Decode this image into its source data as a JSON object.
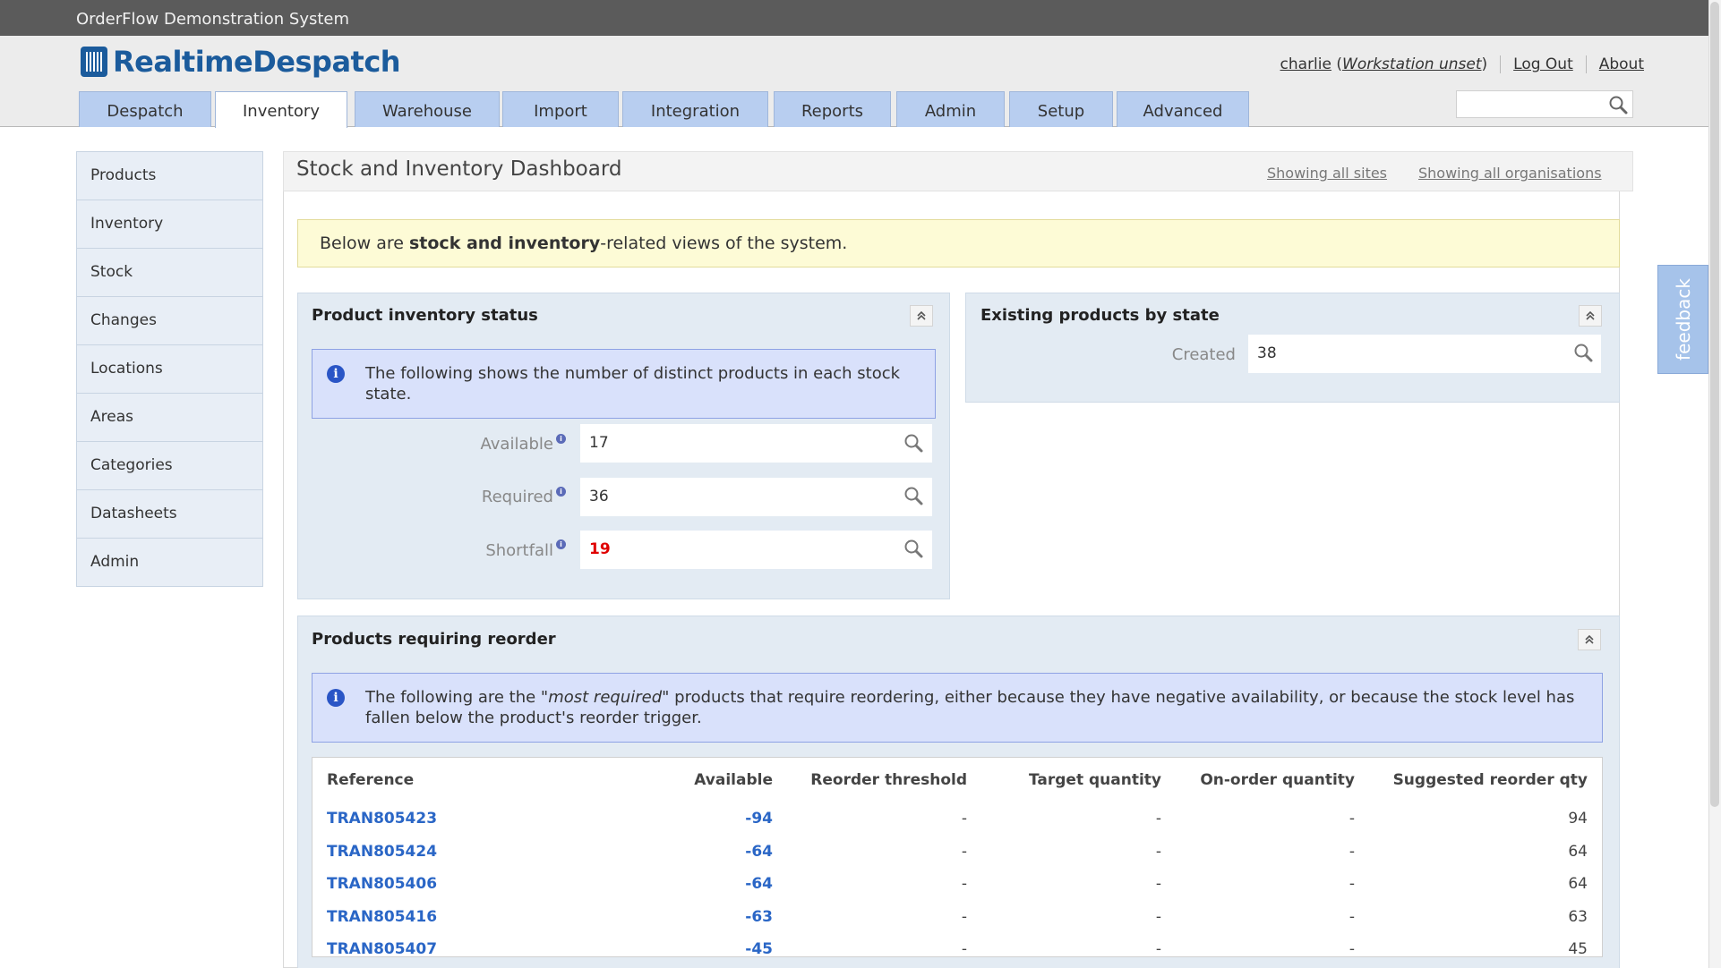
{
  "window": {
    "title": "OrderFlow Demonstration System"
  },
  "brand": {
    "logo_text": "RealtimeDespatch"
  },
  "user": {
    "name": "charlie",
    "workstation": "Workstation unset",
    "logout_label": "Log Out",
    "about_label": "About"
  },
  "tabs": [
    {
      "label": "Despatch"
    },
    {
      "label": "Inventory"
    },
    {
      "label": "Warehouse"
    },
    {
      "label": "Import"
    },
    {
      "label": "Integration"
    },
    {
      "label": "Reports"
    },
    {
      "label": "Admin"
    },
    {
      "label": "Setup"
    },
    {
      "label": "Advanced"
    }
  ],
  "search": {
    "placeholder": ""
  },
  "sidebar": {
    "items": [
      {
        "label": "Products"
      },
      {
        "label": "Inventory"
      },
      {
        "label": "Stock"
      },
      {
        "label": "Changes"
      },
      {
        "label": "Locations"
      },
      {
        "label": "Areas"
      },
      {
        "label": "Categories"
      },
      {
        "label": "Datasheets"
      },
      {
        "label": "Admin"
      }
    ]
  },
  "main": {
    "title": "Stock and Inventory Dashboard",
    "sites_link": "Showing all sites",
    "orgs_link": "Showing all organisations",
    "notice_pre": "Below are ",
    "notice_bold": "stock and inventory",
    "notice_post": "-related views of the system."
  },
  "inventory_status": {
    "title": "Product inventory status",
    "info": "The following shows the number of distinct products in each stock state.",
    "fields": [
      {
        "label": "Available",
        "value": "17"
      },
      {
        "label": "Required",
        "value": "36"
      },
      {
        "label": "Shortfall",
        "value": "19"
      }
    ],
    "shortfall_color": "#e00000"
  },
  "products_by_state": {
    "title": "Existing products by state",
    "fields": [
      {
        "label": "Created",
        "value": "38"
      }
    ]
  },
  "reorder": {
    "title": "Products requiring reorder",
    "info_pre": "The following are the \"",
    "info_em": "most required",
    "info_post": "\" products that require reordering, either because they have negative availability, or because the stock level has fallen below the product's reorder trigger.",
    "columns": [
      "Reference",
      "Available",
      "Reorder threshold",
      "Target quantity",
      "On-order quantity",
      "Suggested reorder qty"
    ],
    "rows": [
      {
        "reference": "TRAN805423",
        "available": "-94",
        "threshold": "-",
        "target": "-",
        "on_order": "-",
        "suggested": "94"
      },
      {
        "reference": "TRAN805424",
        "available": "-64",
        "threshold": "-",
        "target": "-",
        "on_order": "-",
        "suggested": "64"
      },
      {
        "reference": "TRAN805406",
        "available": "-64",
        "threshold": "-",
        "target": "-",
        "on_order": "-",
        "suggested": "64"
      },
      {
        "reference": "TRAN805416",
        "available": "-63",
        "threshold": "-",
        "target": "-",
        "on_order": "-",
        "suggested": "63"
      },
      {
        "reference": "TRAN805407",
        "available": "-45",
        "threshold": "-",
        "target": "-",
        "on_order": "-",
        "suggested": "45"
      }
    ]
  },
  "feedback": {
    "label": "feedback"
  },
  "colors": {
    "accent": "#1b5b9c",
    "tab": "#b8cef0",
    "link": "#2a66c6"
  }
}
